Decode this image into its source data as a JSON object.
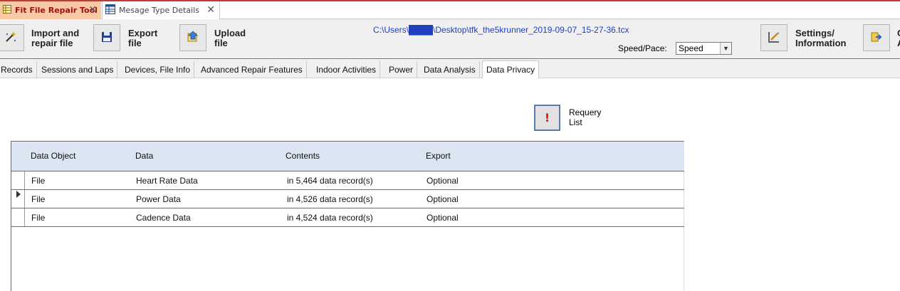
{
  "doc_tabs": [
    {
      "label": "Fit File Repair Tool",
      "icon": "table-icon",
      "active": true
    },
    {
      "label": "Mesage Type Details",
      "icon": "table-icon",
      "active": false
    }
  ],
  "toolbar": {
    "import_label": "Import and\nrepair file",
    "export_label": "Export\nfile",
    "upload_label": "Upload\nfile",
    "settings_label": "Settings/\nInformation",
    "partial_label": "C\nA",
    "file_path": "C:\\Users\\████\\Desktop\\tfk_the5krunner_2019-09-07_15-27-36.tcx",
    "speed_pace_label": "Speed/Pace:",
    "speed_pace_value": "Speed"
  },
  "module_tabs": [
    "Records",
    "Sessions and Laps",
    "Devices, File Info",
    "Advanced Repair Features",
    "Indoor Activities",
    "Power",
    "Data Analysis",
    "Data Privacy"
  ],
  "active_module_tab": "Data Privacy",
  "requery": {
    "label": "Requery\nList",
    "icon": "exclamation-icon"
  },
  "grid": {
    "columns": [
      "Data Object",
      "Data",
      "Contents",
      "Export"
    ],
    "rows": [
      {
        "object": "File",
        "data": "Heart Rate Data",
        "contents": "in 5,464 data record(s)",
        "export": "Optional"
      },
      {
        "object": "File",
        "data": "Power Data",
        "contents": "in 4,526 data record(s)",
        "export": "Optional"
      },
      {
        "object": "File",
        "data": "Cadence Data",
        "contents": "in 4,524 data record(s)",
        "export": "Optional"
      }
    ]
  },
  "colors": {
    "active_tab_bg": "#f9c9a3",
    "active_tab_text": "#a01010",
    "path_text": "#1f3fbf",
    "grid_header_bg": "#dbe6f2"
  }
}
